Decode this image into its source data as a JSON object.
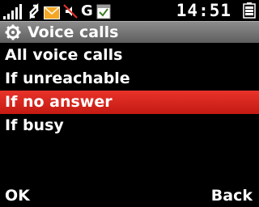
{
  "status_bar": {
    "icons": [
      "signal-strength-icon",
      "data-transfer-icon",
      "message-envelope-icon",
      "mute-icon",
      "gprs-indicator-icon",
      "calendar-alarm-icon",
      "battery-icon"
    ],
    "gprs_label": "G",
    "time": "14:51"
  },
  "header": {
    "icon": "gear-icon",
    "title": "Voice calls"
  },
  "menu": {
    "items": [
      {
        "label": "All voice calls",
        "selected": false
      },
      {
        "label": "If unreachable",
        "selected": false
      },
      {
        "label": "If no answer",
        "selected": true
      },
      {
        "label": "If busy",
        "selected": false
      }
    ]
  },
  "softkeys": {
    "left": "OK",
    "right": "Back"
  },
  "colors": {
    "selection": "#d9251d",
    "title_bar": "#777777",
    "background": "#000000"
  }
}
